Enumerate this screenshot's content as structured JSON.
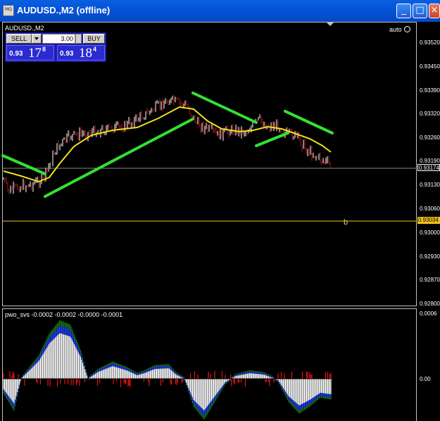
{
  "window": {
    "title": "AUDUSD.,M2 (offline)",
    "icon_text": "MQ",
    "minimize_glyph": "_",
    "maximize_glyph": "□",
    "close_glyph": "×"
  },
  "chart": {
    "symbol_label": "AUDUSD.,M2",
    "auto_label": "auto",
    "price_axis": [
      "0.93520",
      "0.93450",
      "0.93390",
      "0.93320",
      "0.93260",
      "0.93190",
      "0.93130",
      "0.93060",
      "0.93000",
      "0.92930",
      "0.92870",
      "0.92800"
    ],
    "current_price_box": "0.93174",
    "level_price_box": "0.93034",
    "level_label": "b"
  },
  "trade_panel": {
    "sell_label": "SELL",
    "buy_label": "BUY",
    "lot_value": "3.00",
    "sell_quote": {
      "prefix": "0.93",
      "big": "17",
      "sup": "8"
    },
    "buy_quote": {
      "prefix": "0.93",
      "big": "18",
      "sup": "4"
    }
  },
  "indicator": {
    "label": "pwo_svs -0.0002 -0.0002 -0.0000 -0.0001",
    "axis": [
      "0.0006",
      "0.00"
    ]
  },
  "colors": {
    "up_candle": "#ffffff",
    "down_candle": "#b01818",
    "ma_line": "#f0e020",
    "trend_line": "#33e033",
    "hist_white": "#ffffff",
    "hist_blue": "#1f3cf0",
    "hist_green": "#117a11",
    "hist_red": "#ee1111"
  }
}
